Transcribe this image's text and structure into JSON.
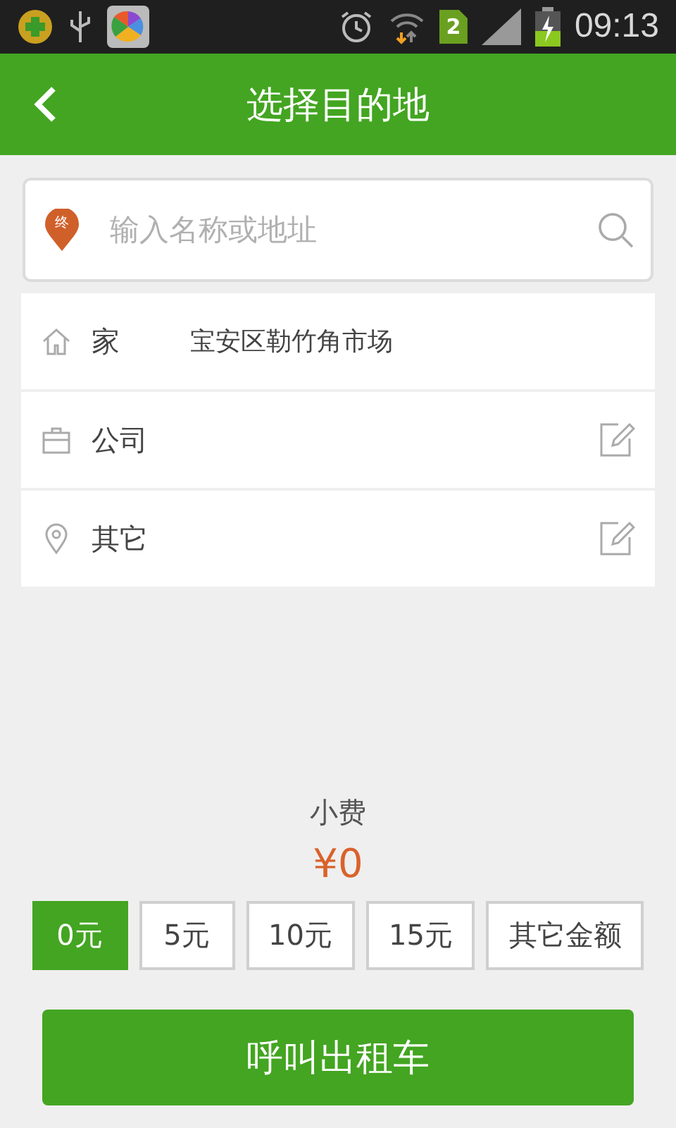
{
  "status_bar": {
    "sim_badge": "2",
    "time": "09:13"
  },
  "header": {
    "title": "选择目的地"
  },
  "search": {
    "pin_label": "终",
    "placeholder": "输入名称或地址"
  },
  "places": [
    {
      "kind": "home",
      "label": "家",
      "address": "宝安区勒竹角市场",
      "editable": false
    },
    {
      "kind": "work",
      "label": "公司",
      "editable": true
    },
    {
      "kind": "other",
      "label": "其它",
      "editable": true
    }
  ],
  "tip": {
    "label": "小费",
    "amount": "¥0",
    "options": [
      {
        "label": "0元",
        "selected": true
      },
      {
        "label": "5元",
        "selected": false
      },
      {
        "label": "10元",
        "selected": false
      },
      {
        "label": "15元",
        "selected": false
      },
      {
        "label": "其它金额",
        "selected": false
      }
    ]
  },
  "call_button": "呼叫出租车"
}
